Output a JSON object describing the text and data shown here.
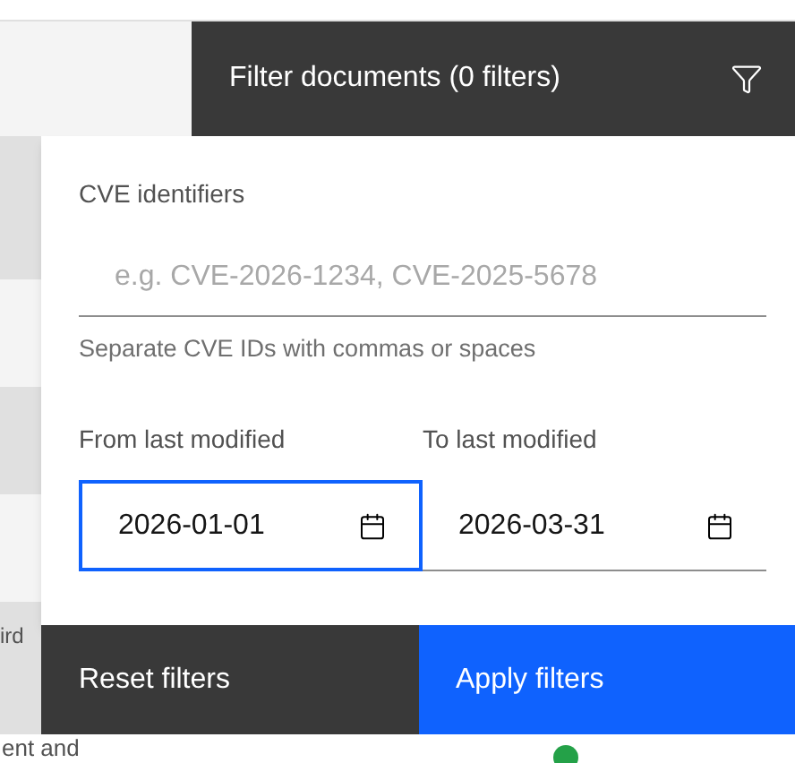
{
  "background": {
    "row_texts": [
      "ird",
      "ent and"
    ],
    "status_dot": {
      "color": "#24a148"
    }
  },
  "filter_panel": {
    "title": "Filter documents (0 filters)",
    "cve": {
      "label": "CVE identifiers",
      "placeholder": "e.g. CVE-2026-1234, CVE-2025-5678",
      "helper": "Separate CVE IDs with commas or spaces"
    },
    "dates": [
      {
        "label": "From last modified",
        "value": "2026-01-01",
        "focused": true
      },
      {
        "label": "To last modified",
        "value": "2026-03-31",
        "focused": false
      }
    ],
    "buttons": [
      {
        "label": "Reset filters",
        "kind": "secondary"
      },
      {
        "label": "Apply filters",
        "kind": "primary"
      }
    ]
  }
}
